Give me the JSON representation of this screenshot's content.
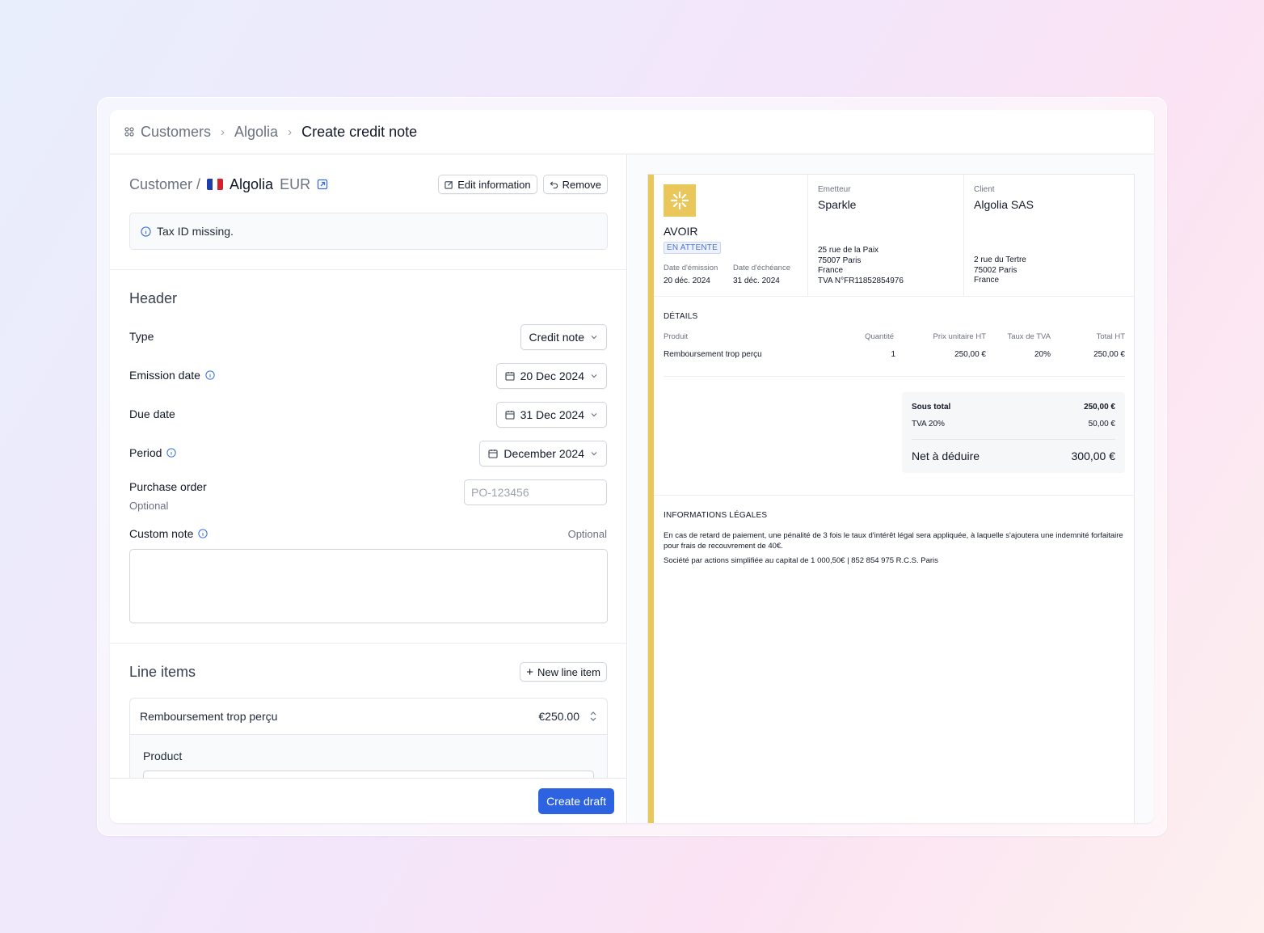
{
  "breadcrumb": {
    "items": [
      "Customers",
      "Algolia"
    ],
    "current": "Create credit note"
  },
  "customer": {
    "label": "Customer /",
    "name": "Algolia",
    "currency": "EUR",
    "edit_label": "Edit information",
    "remove_label": "Remove"
  },
  "alert": {
    "text": "Tax ID missing."
  },
  "header_section": {
    "title": "Header",
    "type_label": "Type",
    "type_value": "Credit note",
    "emission_label": "Emission date",
    "emission_value": "20 Dec 2024",
    "due_label": "Due date",
    "due_value": "31 Dec 2024",
    "period_label": "Period",
    "period_value": "December 2024",
    "po_label": "Purchase order",
    "po_optional": "Optional",
    "po_placeholder": "PO-123456",
    "note_label": "Custom note",
    "note_optional": "Optional"
  },
  "line_items": {
    "title": "Line items",
    "new_label": "New line item",
    "item_name": "Remboursement trop perçu",
    "item_amount": "€250.00",
    "product_label": "Product"
  },
  "footer": {
    "create_label": "Create draft"
  },
  "invoice": {
    "title": "AVOIR",
    "status": "EN ATTENTE",
    "emission_label": "Date d'émission",
    "emission_value": "20 déc. 2024",
    "due_label": "Date d'échéance",
    "due_value": "31 déc. 2024",
    "issuer_label": "Emetteur",
    "issuer_name": "Sparkle",
    "issuer_addr": [
      "25 rue de la Paix",
      "75007 Paris",
      "France",
      "TVA N°FR11852854976"
    ],
    "client_label": "Client",
    "client_name": "Algolia SAS",
    "client_addr": [
      "2 rue du Tertre",
      "75002 Paris",
      "France"
    ],
    "details_title": "DÉTAILS",
    "columns": [
      "Produit",
      "Quantité",
      "Prix unitaire HT",
      "Taux de TVA",
      "Total HT"
    ],
    "row": [
      "Remboursement trop perçu",
      "1",
      "250,00 €",
      "20%",
      "250,00 €"
    ],
    "subtotal_label": "Sous total",
    "subtotal_value": "250,00 €",
    "vat_label": "TVA 20%",
    "vat_value": "50,00 €",
    "net_label": "Net à déduire",
    "net_value": "300,00 €",
    "legal_title": "INFORMATIONS LÉGALES",
    "legal_text_1": "En cas de retard de paiement, une pénalité de 3 fois le taux d'intérêt légal sera appliquée, à laquelle s'ajoutera une indemnité forfaitaire pour frais de recouvrement de 40€.",
    "legal_text_2": "Société par actions simplifiée au capital de 1 000,50€ | 852 854 975 R.C.S. Paris"
  },
  "colors": {
    "primary": "#2d63e0",
    "accent_bar": "#e9c75a",
    "info": "#3b6fd8"
  }
}
